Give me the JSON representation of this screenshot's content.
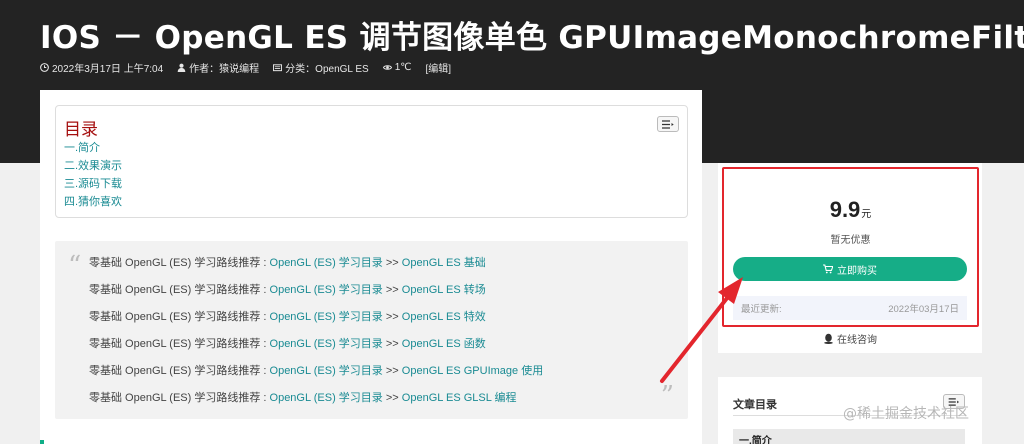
{
  "header": {
    "title": "IOS － OpenGL ES 调节图像单色 GPUImageMonochromeFilter",
    "meta": {
      "date": "2022年3月17日 上午7:04",
      "author": "作者：猿说编程",
      "category": "分类：OpenGL ES",
      "views": "1℃",
      "edit": "[编辑]"
    }
  },
  "toc": {
    "title": "目录",
    "items": [
      "一.简介",
      "二.效果演示",
      "三.源码下载",
      "四.猜你喜欢"
    ]
  },
  "quote": {
    "prefix": "零基础 OpenGL (ES) 学习路线推荐 : ",
    "sep": " >> ",
    "lines": [
      {
        "a": "OpenGL (ES) 学习目录",
        "b": "OpenGL ES 基础"
      },
      {
        "a": "OpenGL (ES) 学习目录",
        "b": "OpenGL ES 转场"
      },
      {
        "a": "OpenGL (ES) 学习目录",
        "b": "OpenGL ES 特效"
      },
      {
        "a": "OpenGL (ES) 学习目录",
        "b": "OpenGL ES 函数"
      },
      {
        "a": "OpenGL (ES) 学习目录",
        "b": "OpenGL ES GPUImage 使用"
      },
      {
        "a": "OpenGL (ES) 学习目录",
        "b": "OpenGL ES GLSL 编程"
      }
    ]
  },
  "sidebar": {
    "price": "9.9",
    "unit": "元",
    "discount": "暂无优惠",
    "buy_label": "立即购买",
    "updated_label": "最近更新:",
    "updated_date": "2022年03月17日",
    "consult": "在线咨询",
    "toc_title": "文章目录",
    "toc_first": "一.简介"
  },
  "watermark": "@稀土掘金技术社区",
  "colors": {
    "accent": "#16ad87",
    "highlight": "#e3262d",
    "link": "#1a8b93",
    "toc_title": "#a50f0f"
  }
}
